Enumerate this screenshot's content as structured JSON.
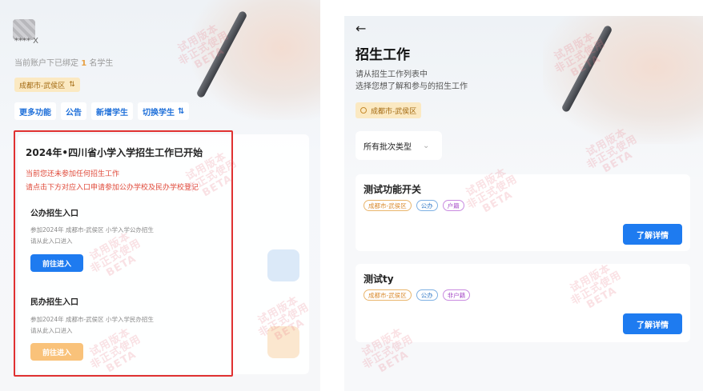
{
  "left": {
    "user_name": "**** X",
    "bound_prefix": "当前账户下已绑定",
    "bound_count": "1",
    "bound_suffix": "名学生",
    "location": "成都市-武侯区",
    "actions": [
      "更多功能",
      "公告",
      "新增学生",
      "切换学生"
    ],
    "card_title": "2024年•四川省小学入学招生工作已开始",
    "warn_lines": [
      "当前您还未参加任何招生工作",
      "请点击下方对应入口申请参加公办学校及民办学校登记"
    ],
    "public": {
      "title": "公办招生入口",
      "desc1": "参加2024年 成都市-武侯区 小学入学公办招生",
      "desc2": "请从此入口进入",
      "button": "前往进入"
    },
    "private": {
      "title": "民办招生入口",
      "desc1": "参加2024年 成都市-武侯区 小学入学民办招生",
      "desc2": "请从此入口进入",
      "button": "前往进入"
    }
  },
  "right": {
    "back_icon": "arrow-left-icon",
    "title": "招生工作",
    "subtitle1": "请从招生工作列表中",
    "subtitle2": "选择您想了解和参与的招生工作",
    "location": "成都市-武侯区",
    "filter": "所有批次类型",
    "items": [
      {
        "title": "测试功能开关",
        "tags": [
          "成都市-武侯区",
          "公办",
          "户籍"
        ],
        "button": "了解详情"
      },
      {
        "title": "测试ty",
        "tags": [
          "成都市-武侯区",
          "公办",
          "非户籍"
        ],
        "button": "了解详情"
      }
    ]
  },
  "watermark": {
    "line1": "试用版本",
    "line2": "非正式使用",
    "line3": "BETA"
  },
  "colors": {
    "primary": "#1e7bf0",
    "highlight": "#e03131",
    "location_bg": "#fbe9c2"
  }
}
